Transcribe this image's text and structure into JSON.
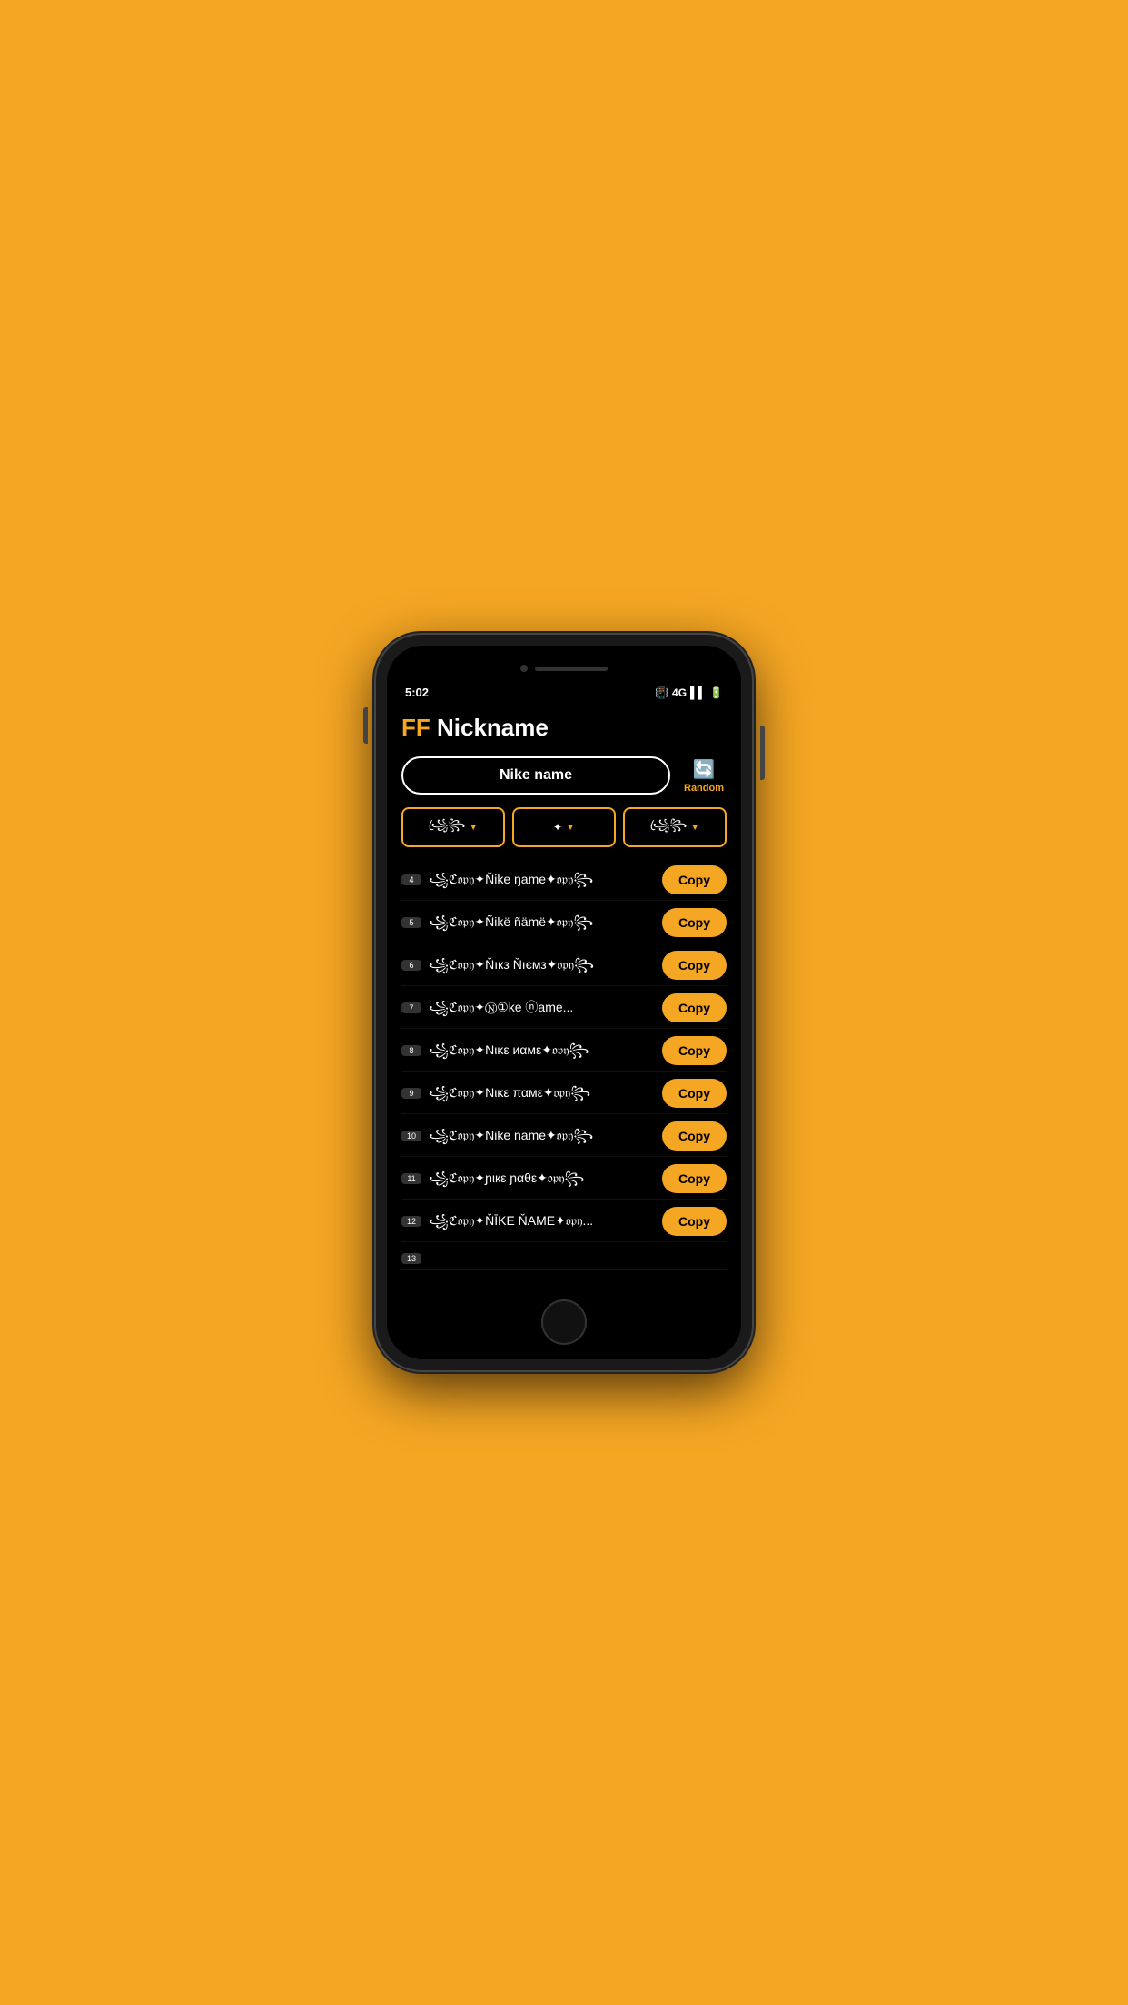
{
  "status_bar": {
    "time": "5:02",
    "icons": [
      "vibrate",
      "4G",
      "signal",
      "battery"
    ]
  },
  "app": {
    "title_prefix": "FF",
    "title_suffix": " Nickname",
    "random_label": "Random"
  },
  "search": {
    "value": "Nike name",
    "placeholder": "Nike name"
  },
  "filters": [
    {
      "label": "꧁꧂",
      "id": "filter1"
    },
    {
      "label": "✦",
      "id": "filter2"
    },
    {
      "label": "꧁꧂",
      "id": "filter3"
    }
  ],
  "copy_label": "Copy",
  "nicknames": [
    {
      "number": "4",
      "text": "꧁ℭ𝔬𝔭𝔶✦Ňike ŋame✦𝔬𝔭𝔶꧂"
    },
    {
      "number": "5",
      "text": "꧁ℭ𝔬𝔭𝔶✦Ñikë ñämë✦𝔬𝔭𝔶꧂"
    },
    {
      "number": "6",
      "text": "꧁ℭ𝔬𝔭𝔶✦Ňıкз Ňıємз✦𝔬𝔭𝔶꧂"
    },
    {
      "number": "7",
      "text": "꧁ℭ𝔬𝔭𝔶✦Ⓝ①ke ⓝame..."
    },
    {
      "number": "8",
      "text": "꧁ℭ𝔬𝔭𝔶✦Nικε иαмε✦𝔬𝔭𝔶꧂"
    },
    {
      "number": "9",
      "text": "꧁ℭ𝔬𝔭𝔶✦Nικε παмε✦𝔬𝔭𝔶꧂"
    },
    {
      "number": "10",
      "text": "꧁ℭ𝔬𝔭𝔶✦Nike name✦𝔬𝔭𝔶꧂"
    },
    {
      "number": "11",
      "text": "꧁ℭ𝔬𝔭𝔶✦ɲιкε ɲαθε✦𝔬𝔭𝔶꧂"
    },
    {
      "number": "12",
      "text": "꧁ℭ𝔬𝔭𝔶✦ŇĪKE ŇAME✦𝔬𝔭𝔶..."
    },
    {
      "number": "13",
      "text": ""
    }
  ]
}
